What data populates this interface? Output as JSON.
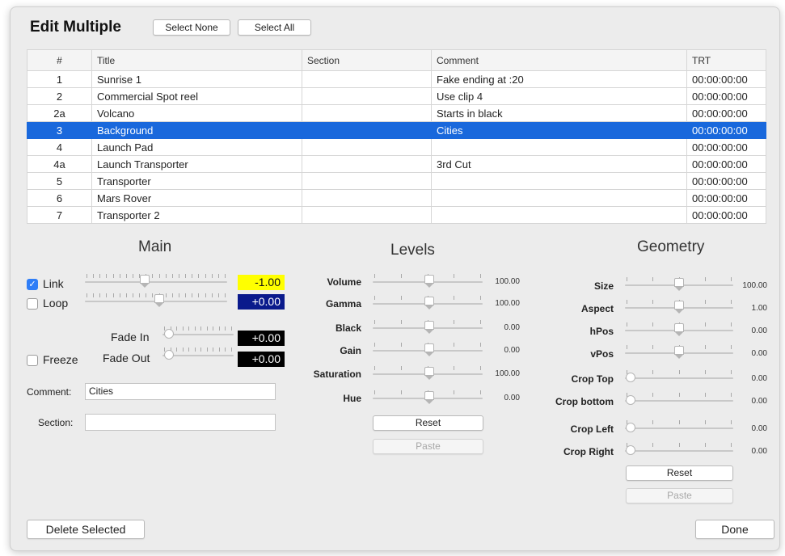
{
  "header": {
    "title": "Edit Multiple",
    "select_none_label": "Select None",
    "select_all_label": "Select All"
  },
  "table": {
    "columns": [
      "#",
      "Title",
      "Section",
      "Comment",
      "TRT"
    ],
    "selected_index": 3,
    "rows": [
      {
        "num": "1",
        "title": "Sunrise 1",
        "section": "",
        "comment": "Fake ending at :20",
        "trt": "00:00:00:00"
      },
      {
        "num": "2",
        "title": "Commercial Spot reel",
        "section": "",
        "comment": "Use clip 4",
        "trt": "00:00:00:00"
      },
      {
        "num": "2a",
        "title": "Volcano",
        "section": "",
        "comment": "Starts in black",
        "trt": "00:00:00:00"
      },
      {
        "num": "3",
        "title": "Background",
        "section": "",
        "comment": "Cities",
        "trt": "00:00:00:00"
      },
      {
        "num": "4",
        "title": "Launch Pad",
        "section": "",
        "comment": "",
        "trt": "00:00:00:00"
      },
      {
        "num": "4a",
        "title": "Launch Transporter",
        "section": "",
        "comment": "3rd Cut",
        "trt": "00:00:00:00"
      },
      {
        "num": "5",
        "title": "Transporter",
        "section": "",
        "comment": "",
        "trt": "00:00:00:00"
      },
      {
        "num": "6",
        "title": "Mars Rover",
        "section": "",
        "comment": "",
        "trt": "00:00:00:00"
      },
      {
        "num": "7",
        "title": "Transporter 2",
        "section": "",
        "comment": "",
        "trt": "00:00:00:00"
      }
    ]
  },
  "main": {
    "heading": "Main",
    "link": {
      "label": "Link",
      "checked": true,
      "value": "-1.00",
      "color": "#ffff00"
    },
    "loop": {
      "label": "Loop",
      "checked": false,
      "value": "+0.00",
      "color": "#0a1a8c"
    },
    "fade_in": {
      "label": "Fade In",
      "value": "+0.00"
    },
    "fade_out": {
      "label": "Fade Out",
      "value": "+0.00"
    },
    "freeze": {
      "label": "Freeze",
      "checked": false
    },
    "comment_label": "Comment:",
    "comment_value": "Cities",
    "section_label": "Section:",
    "section_value": ""
  },
  "levels": {
    "heading": "Levels",
    "rows": [
      {
        "label": "Volume",
        "value": "100.00"
      },
      {
        "label": "Gamma",
        "value": "100.00"
      },
      {
        "label": "Black",
        "value": "0.00"
      },
      {
        "label": "Gain",
        "value": "0.00"
      },
      {
        "label": "Saturation",
        "value": "100.00"
      },
      {
        "label": "Hue",
        "value": "0.00"
      }
    ],
    "reset_label": "Reset",
    "paste_label": "Paste"
  },
  "geometry": {
    "heading": "Geometry",
    "rows": [
      {
        "label": "Size",
        "value": "100.00"
      },
      {
        "label": "Aspect",
        "value": "1.00"
      },
      {
        "label": "hPos",
        "value": "0.00"
      },
      {
        "label": "vPos",
        "value": "0.00"
      },
      {
        "label": "Crop Top",
        "value": "0.00"
      },
      {
        "label": "Crop bottom",
        "value": "0.00"
      },
      {
        "label": "Crop Left",
        "value": "0.00"
      },
      {
        "label": "Crop Right",
        "value": "0.00"
      }
    ],
    "reset_label": "Reset",
    "paste_label": "Paste"
  },
  "footer": {
    "delete_label": "Delete Selected",
    "done_label": "Done"
  }
}
